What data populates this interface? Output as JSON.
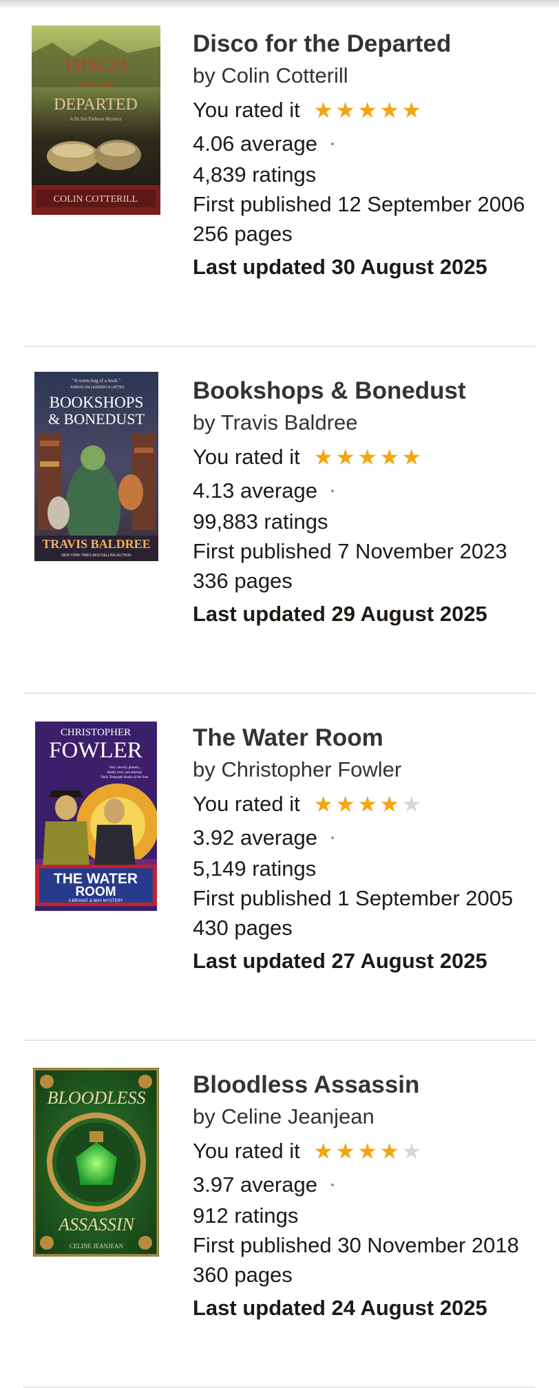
{
  "books": [
    {
      "title": "Disco for the Departed",
      "author": "by Colin Cotterill",
      "rated_label": "You rated it",
      "user_rating": 5,
      "average": "4.06 average",
      "ratings": "4,839 ratings",
      "published": "First published 12 September 2006",
      "pages": "256 pages",
      "updated": "Last updated 30 August 2025",
      "cover": {
        "title_line1": "DISCO",
        "title_line2": "FOR THE",
        "title_line3": "DEPARTED",
        "subtitle": "A Dr Siri Paiboun Mystery",
        "author": "COLIN COTTERILL"
      }
    },
    {
      "title": "Bookshops & Bonedust",
      "author": "by Travis Baldree",
      "rated_label": "You rated it",
      "user_rating": 5,
      "average": "4.13 average",
      "ratings": "99,883 ratings",
      "published": "First published 7 November 2023",
      "pages": "336 pages",
      "updated": "Last updated 29 August 2025",
      "cover": {
        "quote": "\"A warm hug of a book.\"",
        "quote_source": "- KIRKUS ON LEGENDS & LATTES",
        "title_line1": "BOOKSHOPS",
        "title_line2": "& BONEDUST",
        "author": "TRAVIS BALDREE",
        "tagline": "NEW YORK TIMES BESTSELLING AUTHOR"
      }
    },
    {
      "title": "The Water Room",
      "author": "by Christopher Fowler",
      "rated_label": "You rated it",
      "user_rating": 4,
      "average": "3.92 average",
      "ratings": "5,149 ratings",
      "published": "First published 1 September 2005",
      "pages": "430 pages",
      "updated": "Last updated 27 August 2025",
      "cover": {
        "author_first": "CHRISTOPHER",
        "author_last": "FOWLER",
        "quote": "'Very cleverly plotted...",
        "quote2": "deadly story and alluring'",
        "quote_source": "Daily Telegraph Books of the Year",
        "title_line1": "THE WATER",
        "title_line2": "ROOM",
        "series": "A BRYANT & MAY MYSTERY"
      }
    },
    {
      "title": "Bloodless Assassin",
      "author": "by Celine Jeanjean",
      "rated_label": "You rated it",
      "user_rating": 4,
      "average": "3.97 average",
      "ratings": "912 ratings",
      "published": "First published 30 November 2018",
      "pages": "360 pages",
      "updated": "Last updated 24 August 2025",
      "cover": {
        "title_top": "BLOODLESS",
        "title_bottom": "ASSASSIN",
        "author": "CELINE JEANJEAN"
      }
    }
  ],
  "colors": {
    "star_on": "#f3a512",
    "star_off": "#d7d7d7",
    "divider": "#e6e6e6"
  }
}
